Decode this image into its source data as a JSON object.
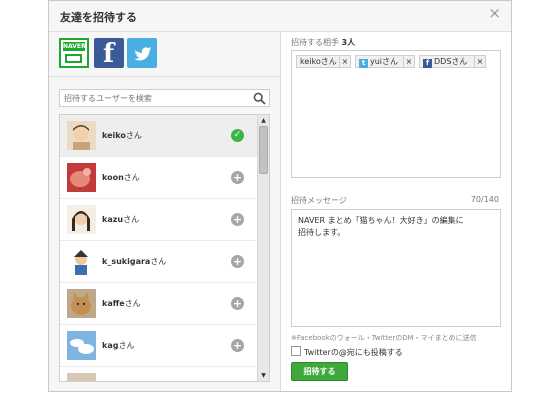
{
  "dialog": {
    "title": "友達を招待する",
    "close": "×"
  },
  "services": {
    "naver": "NAVER"
  },
  "search": {
    "placeholder": "招待するユーザーを検索"
  },
  "users": [
    {
      "name": "keiko",
      "suffix": "さん",
      "state": "selected"
    },
    {
      "name": "koon",
      "suffix": "さん",
      "state": "add"
    },
    {
      "name": "kazu",
      "suffix": "さん",
      "state": "add"
    },
    {
      "name": "k_sukigara",
      "suffix": "さん",
      "state": "add"
    },
    {
      "name": "kaffe",
      "suffix": "さん",
      "state": "add"
    },
    {
      "name": "kag",
      "suffix": "さん",
      "state": "add"
    }
  ],
  "recipients": {
    "label": "招待する相手",
    "count": "3人",
    "tags": [
      {
        "text": "keikoさん",
        "service": "naver"
      },
      {
        "text": "yuiさん",
        "service": "twitter"
      },
      {
        "text": "DDSさん",
        "service": "facebook"
      }
    ],
    "remove": "×"
  },
  "message": {
    "label": "招待メッセージ",
    "counter": "70/140",
    "text": "NAVER まとめ「猫ちゃん！大好き」の編集に\n招待します。"
  },
  "note": "※Facebookのウォール・TwitterのDM・マイまとめに送信",
  "twitter_option": "Twitterの@宛にも投稿する",
  "submit": "招待する",
  "colors": {
    "accent": "#3fa93b",
    "naver": "#1ea830",
    "facebook": "#3b5a98",
    "twitter": "#4aaee3"
  }
}
